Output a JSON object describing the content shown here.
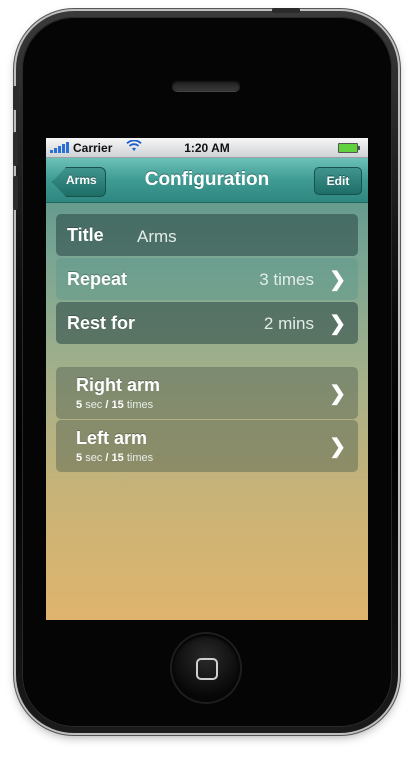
{
  "status_bar": {
    "carrier": "Carrier",
    "time": "1:20 AM",
    "wifi_icon": "wifi-icon",
    "battery_icon": "battery-icon"
  },
  "navbar": {
    "back_label": "Arms",
    "title": "Configuration",
    "edit_label": "Edit"
  },
  "settings": {
    "title_label": "Title",
    "title_value": "Arms",
    "repeat_label": "Repeat",
    "repeat_value": "3 times",
    "rest_label": "Rest for",
    "rest_value": "2 mins"
  },
  "exercises": [
    {
      "name": "Right arm",
      "seconds": "5",
      "sec_unit": "sec",
      "sep": "/",
      "times": "15",
      "times_unit": "times"
    },
    {
      "name": "Left arm",
      "seconds": "5",
      "sec_unit": "sec",
      "sep": "/",
      "times": "15",
      "times_unit": "times"
    }
  ],
  "chevron_glyph": "❯",
  "colors": {
    "navbar": "#3e9b93",
    "screen_top": "#4f8e88",
    "screen_bottom": "#dfb46d"
  }
}
